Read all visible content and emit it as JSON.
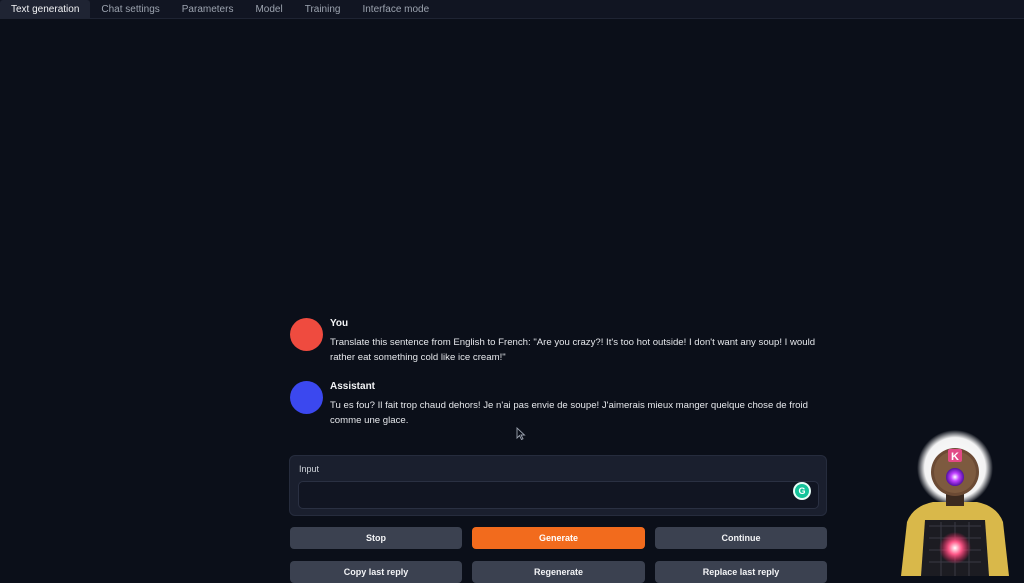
{
  "tabs": [
    {
      "label": "Text generation",
      "active": true
    },
    {
      "label": "Chat settings"
    },
    {
      "label": "Parameters"
    },
    {
      "label": "Model"
    },
    {
      "label": "Training"
    },
    {
      "label": "Interface mode"
    }
  ],
  "chat": {
    "messages": [
      {
        "name": "You",
        "text": "Translate this sentence from English to French: \"Are you crazy?! It's too hot outside! I don't want any soup! I would rather eat something cold like ice cream!\"",
        "avatar_color": "#ef4b3f"
      },
      {
        "name": "Assistant",
        "text": "Tu es fou? Il fait trop chaud dehors! Je n'ai pas envie de soupe! J'aimerais mieux manger quelque chose de froid comme une glace.",
        "avatar_color": "#3b48ef"
      }
    ]
  },
  "input": {
    "label": "Input",
    "value": "",
    "grammarly_icon": "G"
  },
  "buttons": {
    "stop": "Stop",
    "generate": "Generate",
    "continue": "Continue",
    "copy_last_reply": "Copy last reply",
    "regenerate": "Regenerate",
    "replace_last_reply": "Replace last reply"
  },
  "streamer_overlay": {
    "badge": "K"
  },
  "colors": {
    "background": "#0b0f19",
    "accent": "#f26b1d",
    "button": "#3b4150"
  }
}
